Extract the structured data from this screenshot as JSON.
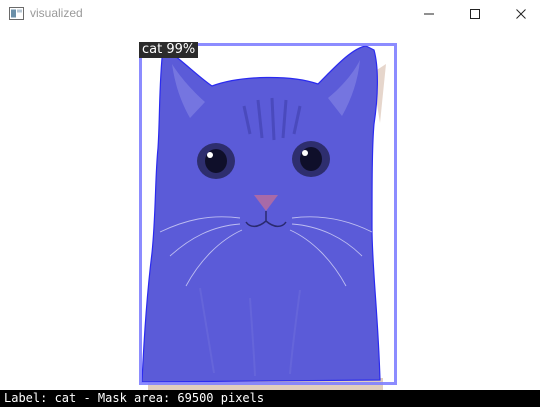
{
  "window": {
    "title": "visualized",
    "controls": [
      "minimize-icon",
      "maximize-icon",
      "close-icon"
    ]
  },
  "detection": {
    "label": "cat",
    "score_text": "cat 99%",
    "mask_color": "#5a5ae6",
    "box_color": "#8080ff"
  },
  "status": {
    "text": "Label: cat - Mask area: 69500 pixels"
  }
}
